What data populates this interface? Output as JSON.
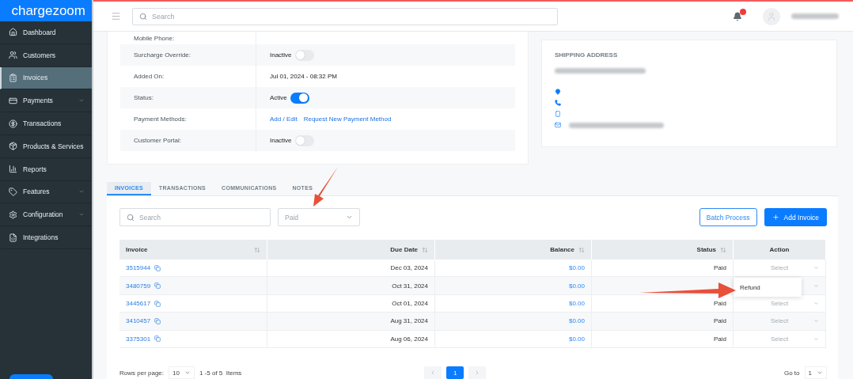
{
  "brand": {
    "name": "chargezoom"
  },
  "sidebar": {
    "items": [
      {
        "label": "Dashboard",
        "selected": false,
        "has_submenu": false
      },
      {
        "label": "Customers",
        "selected": false,
        "has_submenu": false
      },
      {
        "label": "Invoices",
        "selected": true,
        "has_submenu": false
      },
      {
        "label": "Payments",
        "selected": false,
        "has_submenu": true
      },
      {
        "label": "Transactions",
        "selected": false,
        "has_submenu": false
      },
      {
        "label": "Products & Services",
        "selected": false,
        "has_submenu": false
      },
      {
        "label": "Reports",
        "selected": false,
        "has_submenu": false
      },
      {
        "label": "Features",
        "selected": false,
        "has_submenu": true
      },
      {
        "label": "Configuration",
        "selected": false,
        "has_submenu": true
      },
      {
        "label": "Integrations",
        "selected": false,
        "has_submenu": false
      }
    ]
  },
  "topbar": {
    "search_placeholder": "Search"
  },
  "customer_details": {
    "rows": [
      {
        "label": "Mobile Phone:",
        "kind": "text"
      },
      {
        "label": "Surcharge Override:",
        "kind": "toggle",
        "value": "Inactive",
        "on": false
      },
      {
        "label": "Added On:",
        "kind": "text",
        "value": "Jul 01, 2024 - 08:32 PM"
      },
      {
        "label": "Status:",
        "kind": "toggle",
        "value": "Active",
        "on": true
      },
      {
        "label": "Payment Methods:",
        "kind": "links",
        "links": [
          "Add / Edit",
          "Request New Payment Method"
        ]
      },
      {
        "label": "Customer Portal:",
        "kind": "toggle",
        "value": "Inactive",
        "on": false
      }
    ]
  },
  "shipping_address": {
    "title": "SHIPPING ADDRESS"
  },
  "tabs": [
    {
      "label": "INVOICES",
      "selected": true
    },
    {
      "label": "TRANSACTIONS",
      "selected": false
    },
    {
      "label": "COMMUNICATIONS",
      "selected": false
    },
    {
      "label": "NOTES",
      "selected": false
    }
  ],
  "filters": {
    "search_placeholder": "Search",
    "status": "Paid"
  },
  "buttons": {
    "batch": "Batch Process",
    "add": "Add Invoice"
  },
  "table": {
    "columns": [
      {
        "label": "Invoice",
        "sortable": true
      },
      {
        "label": "Due Date",
        "sortable": true
      },
      {
        "label": "Balance",
        "sortable": true
      },
      {
        "label": "Status",
        "sortable": true
      },
      {
        "label": "Action",
        "sortable": false
      }
    ],
    "rows": [
      {
        "invoice": "3515944",
        "due_date": "Dec 03, 2024",
        "balance": "$0.00",
        "status": "Paid",
        "action": "Select"
      },
      {
        "invoice": "3480759",
        "due_date": "Oct 31, 2024",
        "balance": "$0.00"
      },
      {
        "invoice": "3445617",
        "due_date": "Oct 01, 2024",
        "balance": "$0.00",
        "status": "Paid",
        "action": "Select"
      },
      {
        "invoice": "3410457",
        "due_date": "Aug 31, 2024",
        "balance": "$0.00",
        "status": "Paid",
        "action": "Select"
      },
      {
        "invoice": "3375301",
        "due_date": "Aug 06, 2024",
        "balance": "$0.00",
        "status": "Paid",
        "action": "Select"
      }
    ]
  },
  "action_menu": {
    "items": [
      "Refund"
    ]
  },
  "pagination": {
    "rows_per_page_label": "Rows per page:",
    "rows_per_page": "10",
    "summary": "1 -5 of 5  Items",
    "pages": [
      {
        "label": "1",
        "selected": true
      }
    ],
    "goto_label": "Go to",
    "goto_value": "1"
  }
}
